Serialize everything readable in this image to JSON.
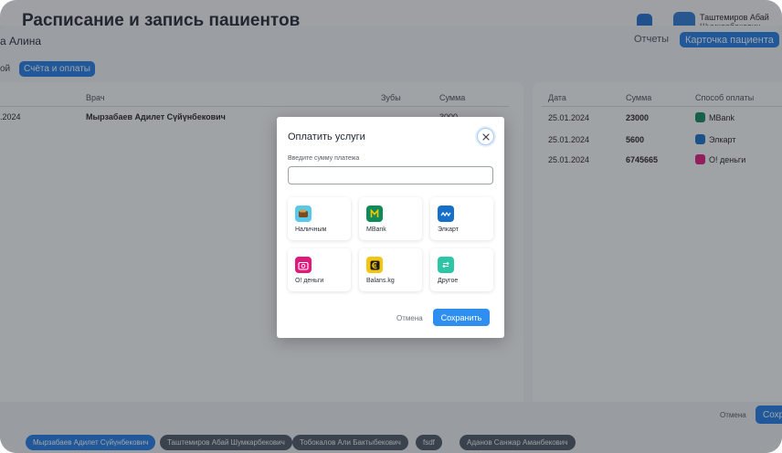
{
  "app": {
    "title": "Расписание и запись пациентов",
    "user_name": "Таштемиров Абай",
    "user_sub": "Шумкарбекович"
  },
  "patient": {
    "name": "а Алина",
    "reports_label": "Отчеты",
    "card_label": "Карточка пациента",
    "tab_cut": "ой",
    "tab_bills": "Счёта и оплаты"
  },
  "services_table": {
    "headers": {
      "doctor": "Врач",
      "teeth": "Зубы",
      "sum": "Сумма"
    },
    "row": {
      "date": ".2024",
      "doctor": "Мырзабаев Адилет Сүйүнбекович",
      "sum": "3000"
    }
  },
  "payments_table": {
    "headers": {
      "date": "Дата",
      "sum": "Сумма",
      "method": "Способ оплаты"
    },
    "rows": [
      {
        "date": "25.01.2024",
        "sum": "23000",
        "method": "MBank"
      },
      {
        "date": "25.01.2024",
        "sum": "5600",
        "method": "Элкарт"
      },
      {
        "date": "25.01.2024",
        "sum": "6745665",
        "method": "О! деньги"
      }
    ]
  },
  "footer": {
    "cancel_label": "Отмена",
    "save_label": "Сохранить"
  },
  "doctor_chips": [
    "Мырзабаев Адилет Сүйүнбекович",
    "Таштемиров Абай Шумкарбекович",
    "Тобокалов Али Бактыбекович",
    "fsdf",
    "Аданов Санжар Аманбекович"
  ],
  "modal": {
    "title": "Оплатить услуги",
    "amount_label": "Введите сумму платежа",
    "amount_value": "",
    "methods": [
      {
        "label": "Наличным",
        "icon": "wallet-icon",
        "color": "#5ac8e8"
      },
      {
        "label": "MBank",
        "icon": "mbank-icon",
        "color": "#0f8b5a"
      },
      {
        "label": "Элкарт",
        "icon": "elcart-icon",
        "color": "#1670c9"
      },
      {
        "label": "О! деньги",
        "icon": "o-dengi-icon",
        "color": "#e0197d"
      },
      {
        "label": "Balans.kg",
        "icon": "balans-icon",
        "color": "#f2c511"
      },
      {
        "label": "Другое",
        "icon": "other-icon",
        "color": "#2ec4a6"
      }
    ],
    "cancel_label": "Отмена",
    "save_label": "Сохранить"
  },
  "colors": {
    "accent": "#1e7be6",
    "overlay": "rgba(35,40,48,0.42)"
  }
}
